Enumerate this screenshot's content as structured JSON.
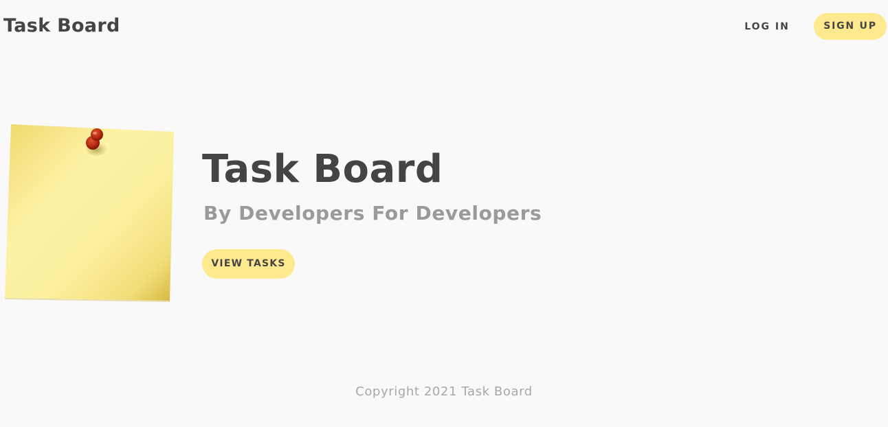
{
  "navbar": {
    "brand": "Task Board",
    "login_label": "LOG IN",
    "signup_label": "SIGN UP"
  },
  "hero": {
    "image_icon": "sticky-note-with-pushpin",
    "title": "Task Board",
    "subtitle": "By Developers For Developers",
    "cta_label": "VIEW TASKS"
  },
  "footer": {
    "copyright": "Copyright 2021 Task Board"
  },
  "colors": {
    "background": "#f9f9f9",
    "accent": "#ffe98f",
    "text_dark": "#444444",
    "text_muted": "#9a9a9a",
    "footer_text": "#a8a8a8",
    "note_yellow": "#f7e98a",
    "pin_red": "#b3280f"
  }
}
